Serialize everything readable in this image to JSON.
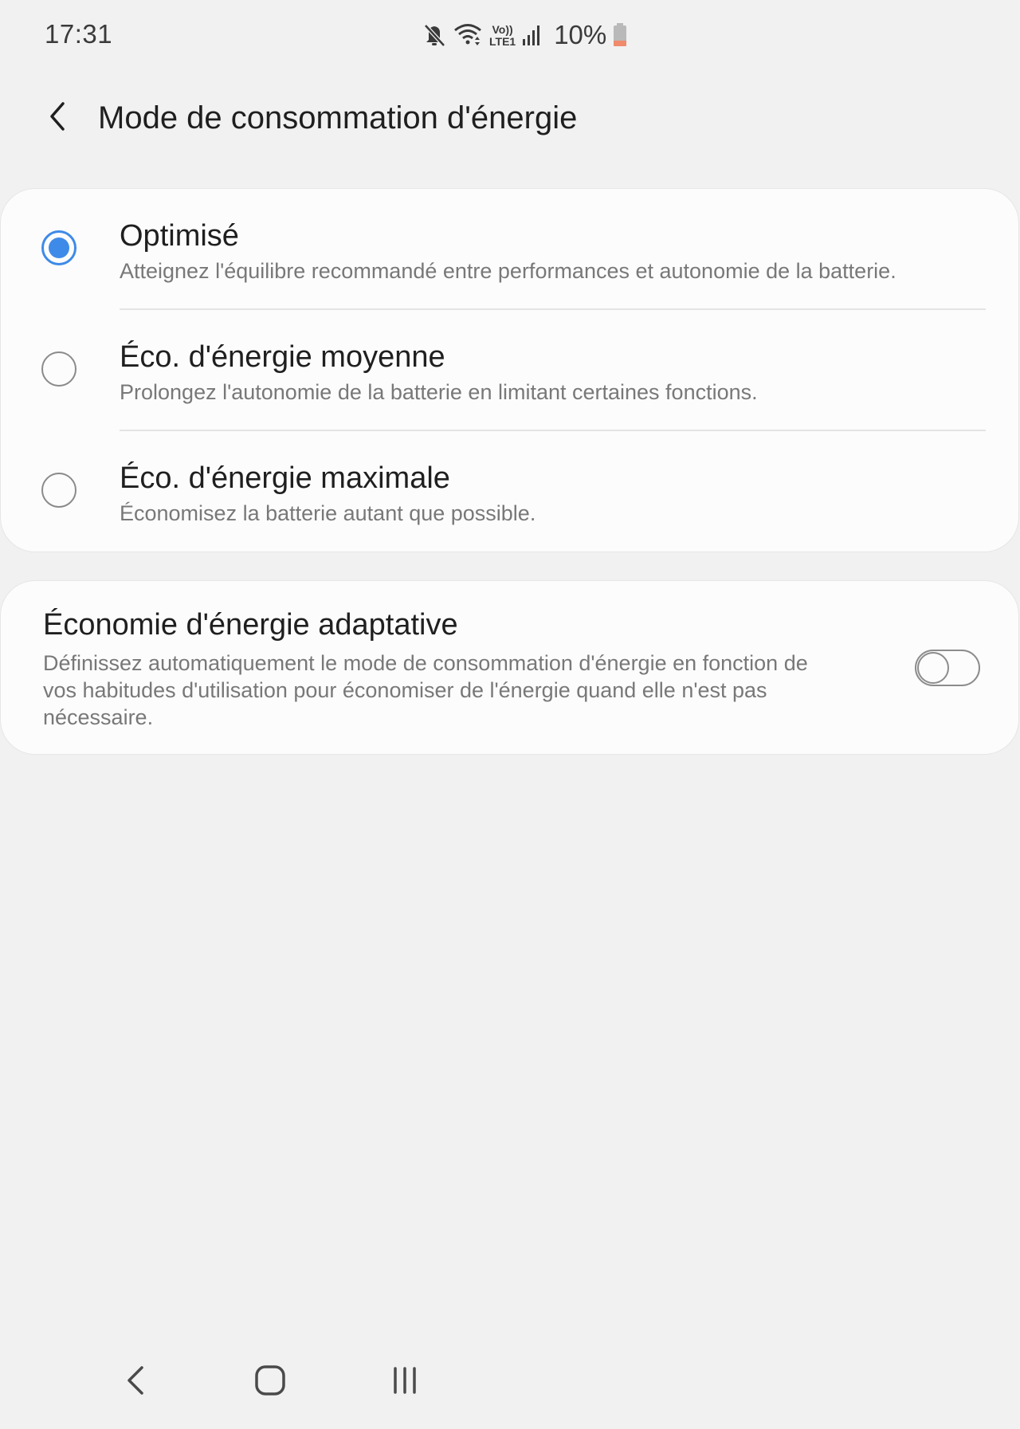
{
  "status_bar": {
    "time": "17:31",
    "battery_percent": "10%",
    "icons": [
      "mute-icon",
      "wifi-icon",
      "volte-lte-icon",
      "signal-icon",
      "battery-low-icon"
    ],
    "volte_label": "Vo))",
    "lte_label": "LTE1",
    "battery_color": "#f08a6c"
  },
  "header": {
    "title": "Mode de consommation d'énergie",
    "back_icon": "chevron-left-icon"
  },
  "modes": [
    {
      "title": "Optimisé",
      "description": "Atteignez l'équilibre recommandé entre performances et autonomie de la batterie.",
      "selected": true
    },
    {
      "title": "Éco. d'énergie moyenne",
      "description": "Prolongez l'autonomie de la batterie en limitant certaines fonctions.",
      "selected": false
    },
    {
      "title": "Éco. d'énergie maximale",
      "description": "Économisez la batterie autant que possible.",
      "selected": false
    }
  ],
  "adaptive": {
    "title": "Économie d'énergie adaptative",
    "description": "Définissez automatiquement le mode de consommation d'énergie en fonction de vos habitudes d'utilisation pour économiser de l'énergie quand elle n'est pas nécessaire.",
    "enabled": false
  },
  "nav_bar": {
    "buttons": [
      "nav-back-icon",
      "nav-home-icon",
      "nav-recents-icon"
    ]
  },
  "colors": {
    "accent": "#3e8ae8",
    "background": "#f1f1f1",
    "card": "#fcfcfc",
    "secondary_text": "#787878"
  }
}
